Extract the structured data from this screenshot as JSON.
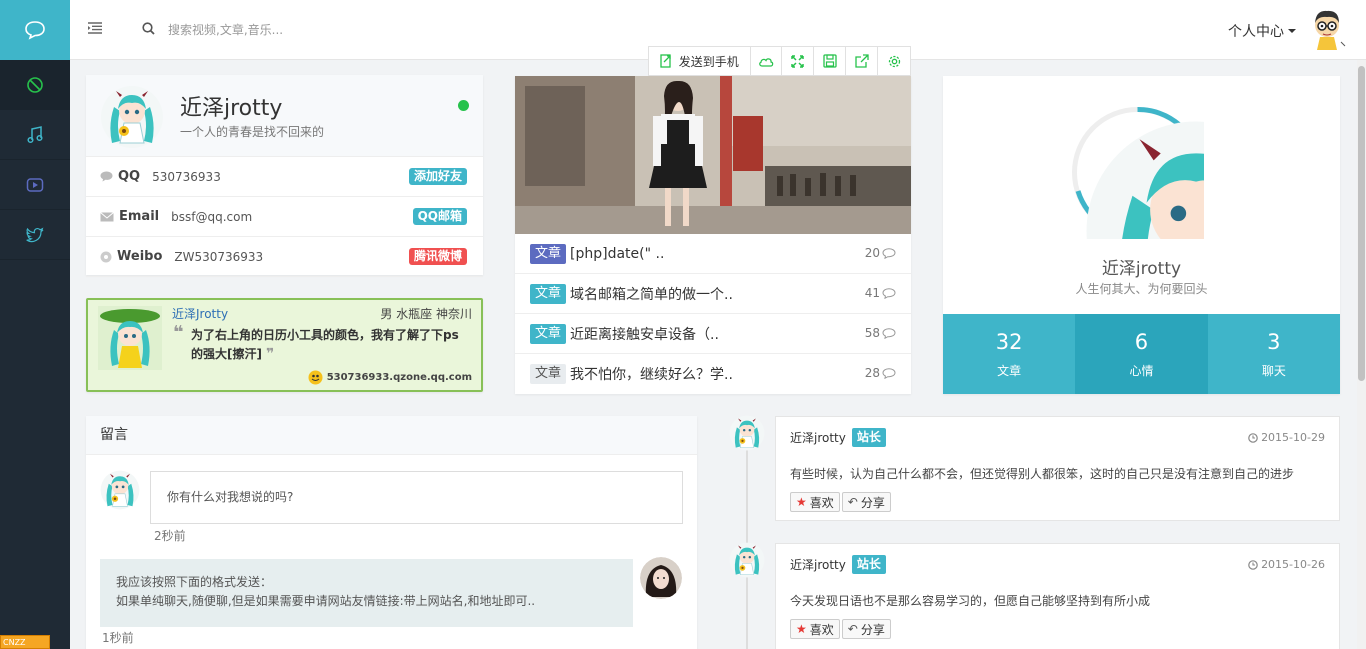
{
  "topbar": {
    "search_placeholder": "搜索视频,文章,音乐...",
    "user_menu": "个人中心"
  },
  "sidebar": {
    "items": [
      {
        "icon": "chat-bubble-icon"
      },
      {
        "icon": "disabled-circle-icon"
      },
      {
        "icon": "music-note-icon"
      },
      {
        "icon": "video-play-icon"
      },
      {
        "icon": "twitter-bird-icon"
      }
    ],
    "cnzz": "CNZZ"
  },
  "profile": {
    "name": "近泽jrotty",
    "motto": "一个人的青春是找不回来的",
    "contacts": [
      {
        "label": "QQ",
        "value": "530736933",
        "action": "添加好友",
        "color": "#3fb5c9"
      },
      {
        "label": "Email",
        "value": "bssf@qq.com",
        "action": "QQ邮箱",
        "color": "#3fb5c9"
      },
      {
        "label": "Weibo",
        "value": "ZW530736933",
        "action": "腾讯微博",
        "color": "#f05050"
      }
    ]
  },
  "qzone": {
    "name": "近泽Jrotty",
    "info": "男 水瓶座 神奈川",
    "quote": "为了右上角的日历小工具的颜色，我有了解了下ps的强大[擦汗]",
    "url": "530736933.qzone.qq.com"
  },
  "share_toolbar": {
    "send_label": "发送到手机"
  },
  "articles": [
    {
      "tag": "文章",
      "title": "[php]date(\" ..",
      "count": "20",
      "tag_color": "#5c6bc0"
    },
    {
      "tag": "文章",
      "title": "域名邮箱之简单的做一个..",
      "count": "41",
      "tag_color": "#3fb5c9"
    },
    {
      "tag": "文章",
      "title": "近距离接触安卓设备（..",
      "count": "58",
      "tag_color": "#3fb5c9"
    },
    {
      "tag": "文章",
      "title": "我不怕你，继续好么？学..",
      "count": "28",
      "tag_color": "#e8ecef"
    }
  ],
  "user_card": {
    "name": "近泽jrotty",
    "motto": "人生何其大、为何要回头",
    "stats": [
      {
        "num": "32",
        "label": "文章"
      },
      {
        "num": "6",
        "label": "心情"
      },
      {
        "num": "3",
        "label": "聊天"
      }
    ]
  },
  "messages": {
    "title": "留言",
    "prompt": "你有什么对我想说的吗?",
    "prompt_time": "2秒前",
    "reply_line1": "我应该按照下面的格式发送：",
    "reply_line2": "如果单纯聊天,随便聊,但是如果需要申请网站友情链接:带上网站名,和地址即可..",
    "reply_time": "1秒前"
  },
  "timeline": [
    {
      "name": "近泽jrotty",
      "role": "站长",
      "date": "2015-10-29",
      "text": "有些时候，认为自己什么都不会，但还觉得别人都很笨，这时的自己只是没有注意到自己的进步",
      "like": "喜欢",
      "share": "分享"
    },
    {
      "name": "近泽jrotty",
      "role": "站长",
      "date": "2015-10-26",
      "text": "今天发现日语也不是那么容易学习的，但愿自己能够坚持到有所小成",
      "like": "喜欢",
      "share": "分享"
    }
  ]
}
